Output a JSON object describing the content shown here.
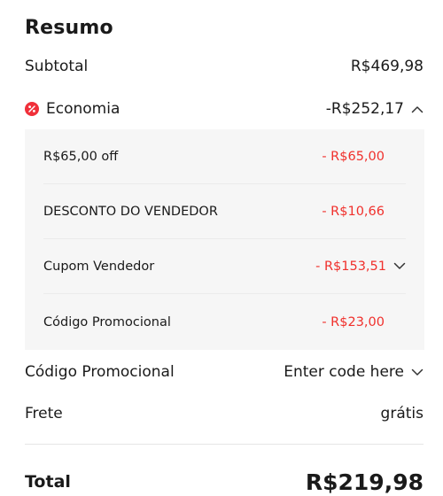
{
  "summary": {
    "title": "Resumo",
    "subtotal_label": "Subtotal",
    "subtotal_value": "R$469,98",
    "economia_label": "Economia",
    "economia_value": "-R$252,17",
    "discounts": [
      {
        "label": "R$65,00 off",
        "value": "- R$65,00"
      },
      {
        "label": "DESCONTO DO VENDEDOR",
        "value": "- R$10,66"
      },
      {
        "label": "Cupom Vendedor",
        "value": "- R$153,51"
      },
      {
        "label": "Código Promocional",
        "value": "- R$23,00"
      }
    ],
    "promo_label": "Código Promocional",
    "promo_placeholder": "Enter code here",
    "frete_label": "Frete",
    "frete_value": "grátis",
    "total_label": "Total",
    "total_value": "R$219,98"
  },
  "colors": {
    "accent_red": "#f0302c",
    "panel_bg": "#f6f6f6"
  },
  "icons": {
    "economia": "discount-badge-icon",
    "economia_toggle": "chevron-up-icon",
    "cupom_toggle": "chevron-down-icon",
    "promo_toggle": "chevron-down-icon"
  }
}
